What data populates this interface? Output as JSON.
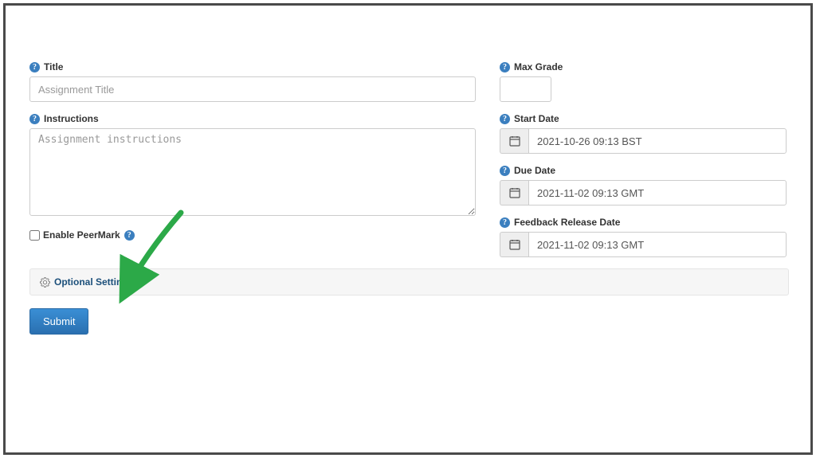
{
  "form": {
    "title": {
      "label": "Title",
      "placeholder": "Assignment Title",
      "value": ""
    },
    "instructions": {
      "label": "Instructions",
      "placeholder": "Assignment instructions",
      "value": ""
    },
    "peermark": {
      "label": "Enable PeerMark"
    },
    "maxgrade": {
      "label": "Max Grade",
      "value": ""
    },
    "startdate": {
      "label": "Start Date",
      "value": "2021-10-26 09:13 BST"
    },
    "duedate": {
      "label": "Due Date",
      "value": "2021-11-02 09:13 GMT"
    },
    "feedbackdate": {
      "label": "Feedback Release Date",
      "value": "2021-11-02 09:13 GMT"
    },
    "optional_settings": "Optional Settings",
    "submit": "Submit"
  }
}
